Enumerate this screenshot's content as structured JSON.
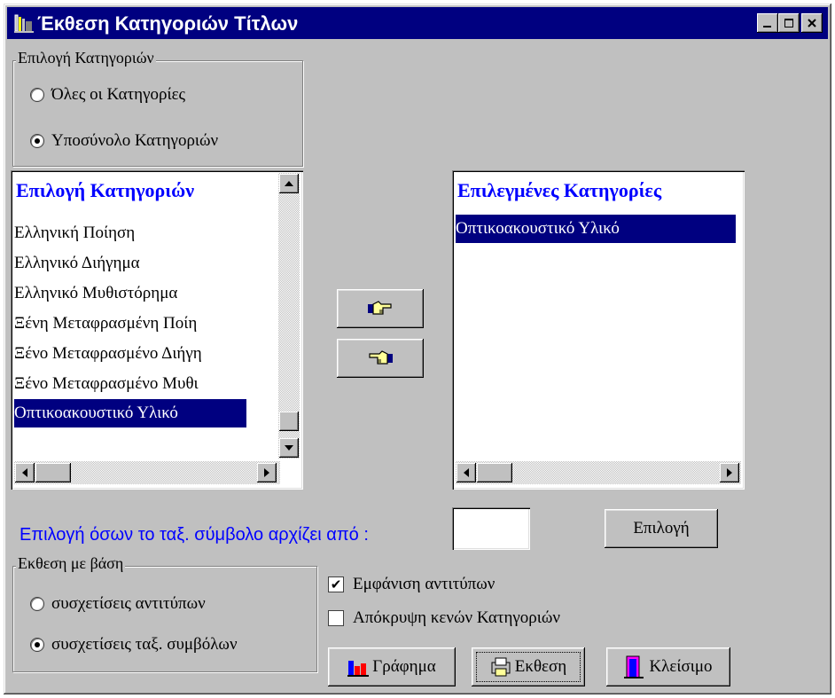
{
  "window": {
    "title": "Έκθεση Κατηγοριών Τίτλων",
    "controls": [
      "minimize",
      "maximize",
      "close"
    ]
  },
  "category_selection": {
    "group_label": "Επιλογή Κατηγοριών",
    "options": [
      {
        "label": "Όλες οι Κατηγορίες",
        "selected": false
      },
      {
        "label": "Υποσύνολο Κατηγοριών",
        "selected": true
      }
    ]
  },
  "available_list": {
    "header": "Επιλογή Κατηγοριών",
    "items": [
      {
        "label": "Ελληνική Ποίηση",
        "selected": false
      },
      {
        "label": "Ελληνικό Διήγημα",
        "selected": false
      },
      {
        "label": "Ελληνικό Μυθιστόρημα",
        "selected": false
      },
      {
        "label": "Ξένη Μεταφρασμένη Ποίη",
        "selected": false
      },
      {
        "label": "Ξένο Μεταφρασμένο Διήγη",
        "selected": false
      },
      {
        "label": "Ξένο Μεταφρασμένο Μυθι",
        "selected": false
      },
      {
        "label": "Οπτικοακουστικό Υλικό",
        "selected": true
      }
    ]
  },
  "selected_list": {
    "header": "Επιλεγμένες Κατηγορίες",
    "items": [
      {
        "label": "Οπτικοακουστικό Υλικό",
        "selected": true
      }
    ]
  },
  "transfer_buttons": {
    "add_icon": "hand-pointing-right-icon",
    "remove_icon": "hand-pointing-left-icon"
  },
  "prefix_filter": {
    "label": "Επιλογή όσων το ταξ. σύμβολο αρχίζει από :",
    "value": "",
    "button_label": "Επιλογή"
  },
  "report_basis": {
    "group_label": "Εκθεση με βάση",
    "options": [
      {
        "label": "συσχετίσεις αντιτύπων",
        "selected": false
      },
      {
        "label": "συσχετίσεις ταξ. συμβόλων",
        "selected": true
      }
    ]
  },
  "checkboxes": [
    {
      "label": "Εμφάνιση αντιτύπων",
      "checked": true
    },
    {
      "label": "Απόκρυψη κενών Κατηγοριών",
      "checked": false
    }
  ],
  "actions": {
    "chart_label": "Γράφημα",
    "report_label": "Εκθεση",
    "close_label": "Κλείσιμο"
  },
  "colors": {
    "titlebar": "#000080",
    "face": "#c0c0c0",
    "header_text": "#0000ff",
    "selection": "#000080"
  }
}
